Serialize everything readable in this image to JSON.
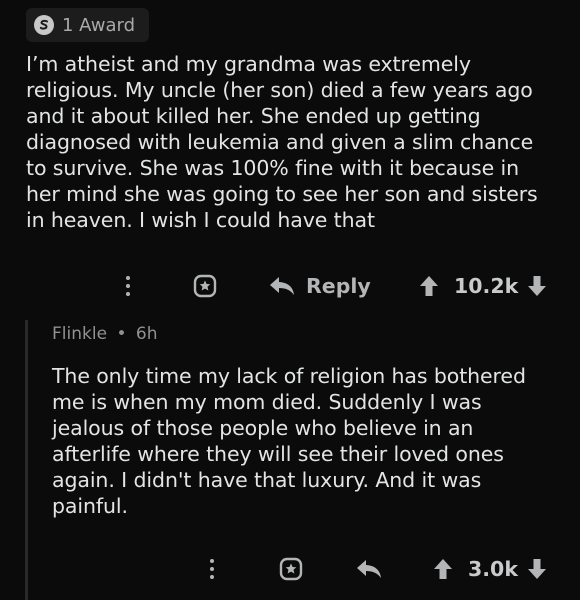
{
  "parent_comment": {
    "award": {
      "icon": "silver-award-icon",
      "label": "1 Award"
    },
    "body": "I’m atheist and my grandma was extremely religious. My uncle (her son) died a few years ago and it about killed her. She ended up getting diagnosed with leukemia and given a slim chance to survive. She was 100% fine with it because in her mind she was going to see her son and sisters in heaven. I wish I could have that",
    "actions": {
      "more_icon": "more-vertical-icon",
      "award_icon": "give-award-icon",
      "reply_icon": "reply-arrow-icon",
      "reply_label": "Reply",
      "vote_count": "10.2k"
    }
  },
  "reply_comment": {
    "author": "Flinkle",
    "separator": "•",
    "age": "6h",
    "body": "The only time my lack of religion has bothered me is when my mom died. Suddenly I was jealous of those people who believe in an afterlife where they will see their loved ones again. I didn't have that luxury. And it was painful.",
    "actions": {
      "more_icon": "more-vertical-icon",
      "award_icon": "give-award-icon",
      "reply_icon": "reply-arrow-icon",
      "vote_count": "3.0k"
    }
  },
  "colors": {
    "background": "#0b0b0b",
    "text": "#e3e4e5",
    "muted": "#8f9193",
    "icon": "#b3b5b7"
  }
}
